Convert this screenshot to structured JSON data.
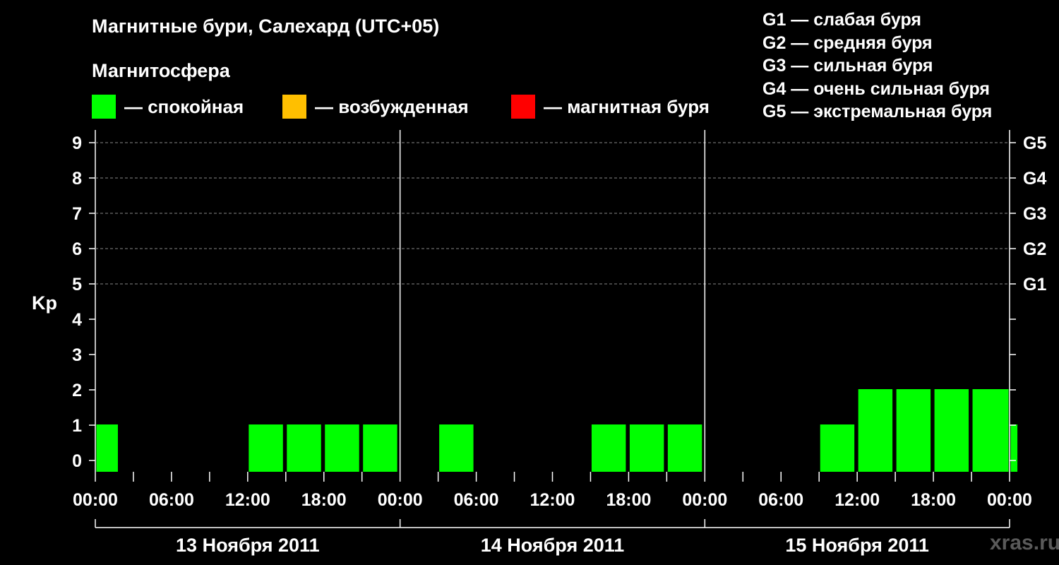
{
  "header": {
    "title": "Магнитные бури, Салехард (UTC+05)",
    "subtitle": "Магнитосфера"
  },
  "legend": [
    {
      "label": "— спокойная",
      "color": "#00ff00"
    },
    {
      "label": "— возбужденная",
      "color": "#ffbf00"
    },
    {
      "label": "— магнитная буря",
      "color": "#ff0000"
    }
  ],
  "g_scale": [
    "G1 — слабая буря",
    "G2 — средняя буря",
    "G3 — сильная буря",
    "G4 — очень сильная буря",
    "G5 — экстремальная буря"
  ],
  "watermark": "xras.ru",
  "chart_data": {
    "type": "bar",
    "title": "Магнитные бури, Салехард (UTC+05)",
    "ylabel": "Kp",
    "ylim": [
      0,
      9
    ],
    "yticks": [
      "0",
      "1",
      "2",
      "3",
      "4",
      "5",
      "6",
      "7",
      "8",
      "9"
    ],
    "right_ticks": [
      {
        "kp": 5,
        "label": "G1"
      },
      {
        "kp": 6,
        "label": "G2"
      },
      {
        "kp": 7,
        "label": "G3"
      },
      {
        "kp": 8,
        "label": "G4"
      },
      {
        "kp": 9,
        "label": "G5"
      }
    ],
    "grid": "dashed horizontal at Kp 5-9",
    "xticks": [
      "00:00",
      "06:00",
      "12:00",
      "18:00",
      "00:00",
      "06:00",
      "12:00",
      "18:00",
      "00:00",
      "06:00",
      "12:00",
      "18:00",
      "00:00"
    ],
    "days": [
      "13 Ноября 2011",
      "14 Ноября 2011",
      "15 Ноября 2011"
    ],
    "bar_color": "#00ff00",
    "bars": [
      {
        "start_h": 0,
        "end_h": 2,
        "kp": 1
      },
      {
        "start_h": 12,
        "end_h": 15,
        "kp": 1
      },
      {
        "start_h": 15,
        "end_h": 18,
        "kp": 1
      },
      {
        "start_h": 18,
        "end_h": 21,
        "kp": 1
      },
      {
        "start_h": 21,
        "end_h": 24,
        "kp": 1
      },
      {
        "start_h": 27,
        "end_h": 30,
        "kp": 1
      },
      {
        "start_h": 39,
        "end_h": 42,
        "kp": 1
      },
      {
        "start_h": 42,
        "end_h": 45,
        "kp": 1
      },
      {
        "start_h": 45,
        "end_h": 48,
        "kp": 1
      },
      {
        "start_h": 57,
        "end_h": 60,
        "kp": 1
      },
      {
        "start_h": 60,
        "end_h": 63,
        "kp": 2
      },
      {
        "start_h": 63,
        "end_h": 66,
        "kp": 2
      },
      {
        "start_h": 66,
        "end_h": 69,
        "kp": 2
      },
      {
        "start_h": 69,
        "end_h": 72,
        "kp": 2
      },
      {
        "start_h": 72,
        "end_h": 72.7,
        "kp": 1
      }
    ]
  }
}
